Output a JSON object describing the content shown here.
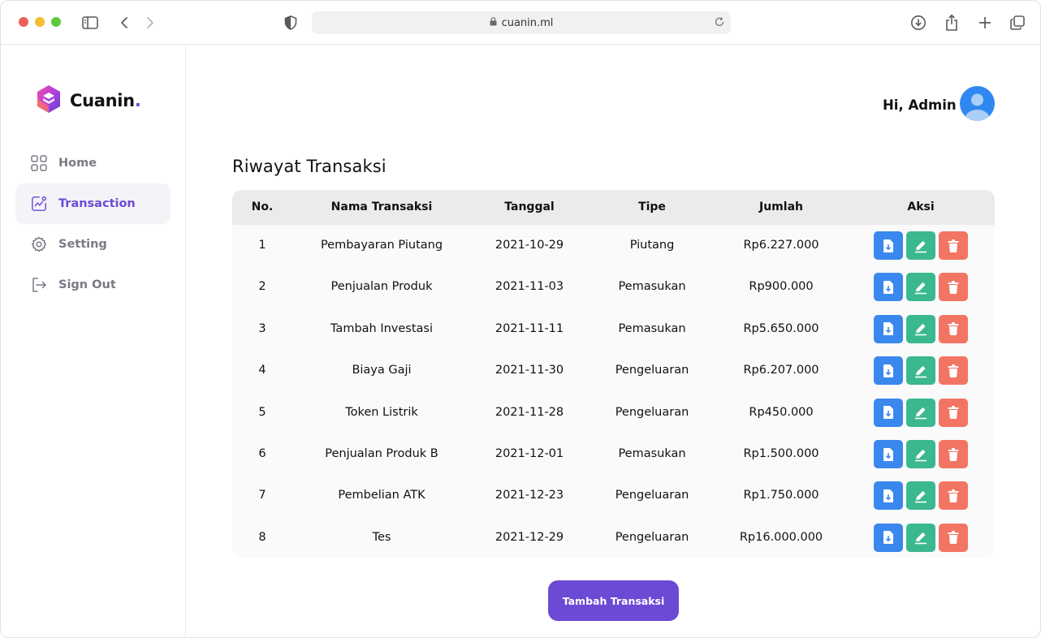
{
  "browser": {
    "url": "cuanin.ml"
  },
  "brand": {
    "name": "Cuanin",
    "dot": ".",
    "accent": "#6c4ad6"
  },
  "sidebar": {
    "items": [
      {
        "label": "Home",
        "icon": "grid-icon"
      },
      {
        "label": "Transaction",
        "icon": "chart-icon",
        "active": true
      },
      {
        "label": "Setting",
        "icon": "gear-icon"
      },
      {
        "label": "Sign Out",
        "icon": "sign-out-icon"
      }
    ]
  },
  "header": {
    "greeting": "Hi, Admin"
  },
  "main": {
    "title": "Riwayat Transaksi",
    "columns": [
      "No.",
      "Nama Transaksi",
      "Tanggal",
      "Tipe",
      "Jumlah",
      "Aksi"
    ],
    "rows": [
      {
        "no": "1",
        "nama": "Pembayaran Piutang",
        "tanggal": "2021-10-29",
        "tipe": "Piutang",
        "jumlah": "Rp6.227.000"
      },
      {
        "no": "2",
        "nama": "Penjualan Produk",
        "tanggal": "2021-11-03",
        "tipe": "Pemasukan",
        "jumlah": "Rp900.000"
      },
      {
        "no": "3",
        "nama": "Tambah Investasi",
        "tanggal": "2021-11-11",
        "tipe": "Pemasukan",
        "jumlah": "Rp5.650.000"
      },
      {
        "no": "4",
        "nama": "Biaya Gaji",
        "tanggal": "2021-11-30",
        "tipe": "Pengeluaran",
        "jumlah": "Rp6.207.000"
      },
      {
        "no": "5",
        "nama": "Token Listrik",
        "tanggal": "2021-11-28",
        "tipe": "Pengeluaran",
        "jumlah": "Rp450.000"
      },
      {
        "no": "6",
        "nama": "Penjualan Produk B",
        "tanggal": "2021-12-01",
        "tipe": "Pemasukan",
        "jumlah": "Rp1.500.000"
      },
      {
        "no": "7",
        "nama": "Pembelian ATK",
        "tanggal": "2021-12-23",
        "tipe": "Pengeluaran",
        "jumlah": "Rp1.750.000"
      },
      {
        "no": "8",
        "nama": "Tes",
        "tanggal": "2021-12-29",
        "tipe": "Pengeluaran",
        "jumlah": "Rp16.000.000"
      }
    ],
    "add_button": "Tambah Transaksi"
  },
  "colors": {
    "download": "#3a88ee",
    "edit": "#3bb88f",
    "delete": "#f27564"
  }
}
